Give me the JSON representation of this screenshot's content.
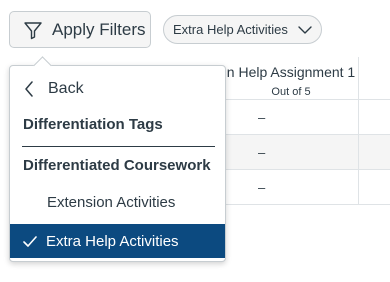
{
  "toolbar": {
    "apply_filters_label": "Apply Filters",
    "active_filter_chip": "Extra Help Activities"
  },
  "grid": {
    "column_title": "n Help Assignment 1",
    "column_subtitle": "Out of 5",
    "cells": [
      "–",
      "–",
      "–"
    ]
  },
  "menu": {
    "back_label": "Back",
    "groups": [
      {
        "title": "Differentiation Tags"
      },
      {
        "title": "Differentiated Coursework"
      }
    ],
    "items": [
      {
        "label": "Extension Activities",
        "selected": false
      },
      {
        "label": "Extra Help Activities",
        "selected": true
      }
    ]
  },
  "colors": {
    "selected_bg": "#0c4a80",
    "text": "#2d3b45",
    "border": "#c7cdd1"
  }
}
